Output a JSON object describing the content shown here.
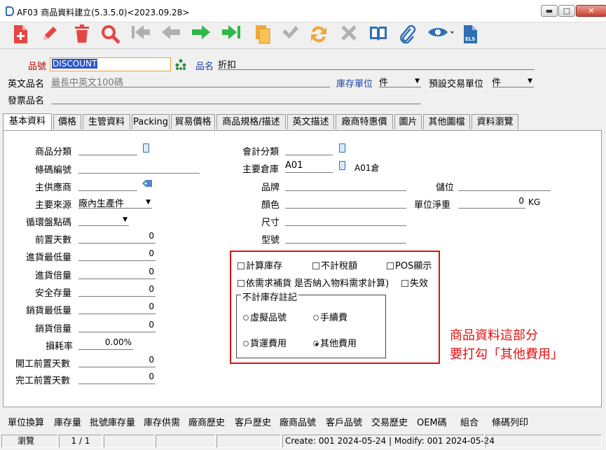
{
  "window": {
    "title": "AF03 商品資料建立(5.3.5.0)<2023.09.28>",
    "buttons": [
      "minimize-icon",
      "maximize-icon",
      "close-icon"
    ]
  },
  "toolbar": {
    "icons": [
      "add-icon",
      "edit-icon",
      "delete-icon",
      "search-icon",
      "first-record-icon",
      "prev-record-icon",
      "next-record-icon",
      "last-record-icon",
      "copy-icon",
      "confirm-icon",
      "refresh-icon",
      "cancel-icon",
      "book-icon",
      "attach-icon",
      "view-icon",
      "excel-export-icon"
    ]
  },
  "header": {
    "sku_label": "品號",
    "sku_value": "DISCOUNT",
    "name_label": "品名",
    "name_value": "折扣",
    "en_name_label": "英文品名",
    "en_name_placeholder": "最長中英文100碼",
    "stock_unit_label": "庫存單位",
    "stock_unit_value": "件",
    "trade_unit_label": "預設交易單位",
    "trade_unit_value": "件",
    "invoice_name_label": "發票品名"
  },
  "tabs": [
    "基本資料",
    "價格",
    "生管資料",
    "Packing",
    "貿易價格",
    "商品規格/描述",
    "英文描述",
    "廠商特惠價",
    "圖片",
    "其他圖檔",
    "資料瀏覽"
  ],
  "basic": {
    "category_label": "商品分類",
    "barcode_label": "條碼編號",
    "main_supplier_label": "主供應商",
    "main_source_label": "主要來源",
    "main_source_value": "廠內生產件",
    "cycle_count_label": "循環盤點碼",
    "lead_days_label": "前置天數",
    "lead_days_value": "0",
    "min_purchase_label": "進貨最低量",
    "min_purchase_value": "0",
    "purchase_multiple_label": "進貨倍量",
    "purchase_multiple_value": "0",
    "safety_stock_label": "安全存量",
    "safety_stock_value": "0",
    "min_sales_label": "銷貨最低量",
    "min_sales_value": "0",
    "sales_multiple_label": "銷貨倍量",
    "sales_multiple_value": "0",
    "loss_rate_label": "損耗率",
    "loss_rate_value": "0.00%",
    "start_lead_label": "開工前置天數",
    "start_lead_value": "0",
    "finish_lead_label": "完工前置天數",
    "finish_lead_value": "0",
    "accounting_category_label": "會計分類",
    "main_warehouse_label": "主要倉庫",
    "main_warehouse_value": "A01",
    "main_warehouse_name": "A01倉",
    "brand_label": "品牌",
    "location_label": "儲位",
    "color_label": "顏色",
    "unit_weight_label": "單位淨重",
    "unit_weight_value": "0",
    "unit_weight_unit": "KG",
    "size_label": "尺寸",
    "model_label": "型號"
  },
  "options": {
    "count_stock": "計算庫存",
    "no_tax": "不計稅額",
    "pos_display": "POS顯示",
    "replenish": "依需求補貨 是否納入物料需求計算)",
    "invalid": "失效",
    "group_title": "不計庫存註記",
    "virtual_item": "虛擬品號",
    "handling_fee": "手續費",
    "freight_fee": "貨運費用",
    "other_fee": "其他費用",
    "selected": "other_fee"
  },
  "annotation": {
    "line1": "商品資料這部分",
    "line2": "要打勾「其他費用」",
    "color": "#e01010"
  },
  "function_bar": [
    "單位換算",
    "庫存量",
    "批號庫存量",
    "庫存供需",
    "廠商歷史",
    "客戶歷史",
    "廠商品號",
    "客戶品號",
    "交易歷史",
    "OEM碼",
    "組合",
    "條碼列印"
  ],
  "status_bar": {
    "mode": "瀏覽",
    "page": "1 / 1",
    "audit": "Create: 001 2024-05-24 | Modify: 001 2024-05-24"
  }
}
